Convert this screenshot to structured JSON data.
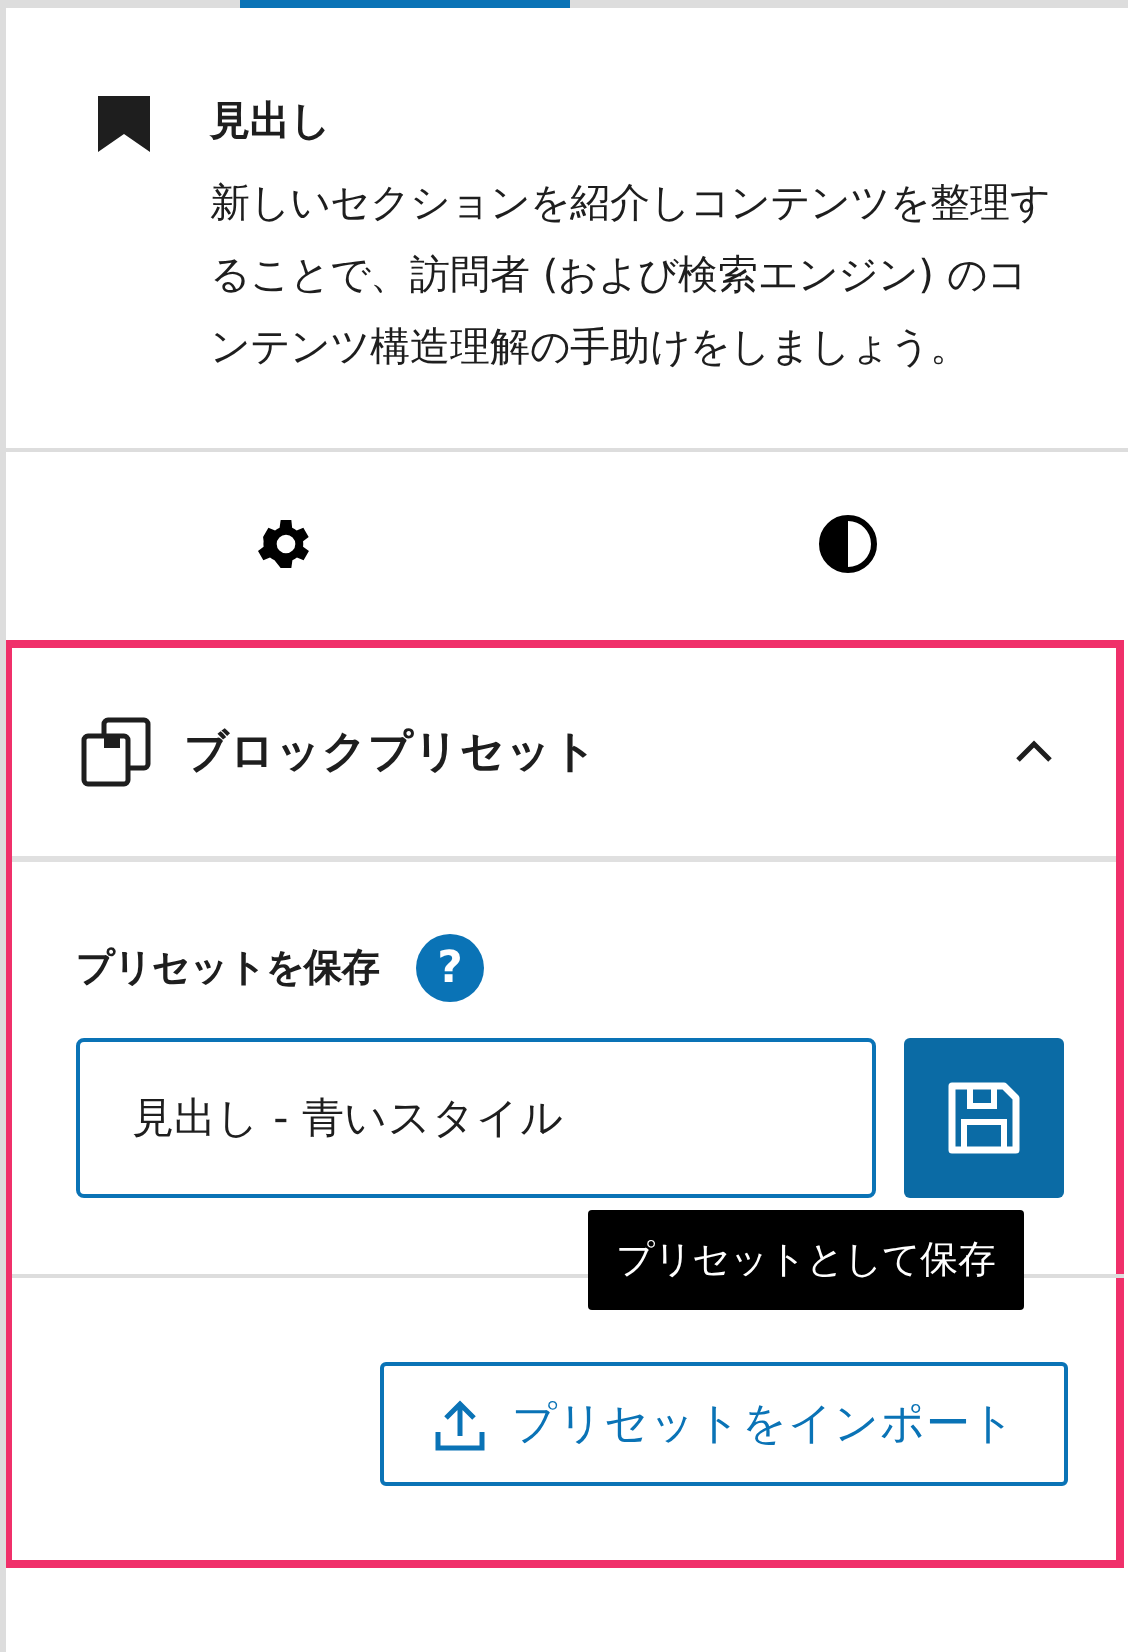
{
  "block": {
    "title": "見出し",
    "description": "新しいセクションを紹介しコンテンツを整理することで、訪問者 (および検索エンジン) のコンテンツ構造理解の手助けをしましょう。"
  },
  "tabs": [
    {
      "kind": "settings",
      "selected": false
    },
    {
      "kind": "styles",
      "selected": false
    }
  ],
  "panel": {
    "title": "ブロックプリセット",
    "expanded": true,
    "save_label": "プリセットを保存",
    "help": "?",
    "preset_name": "見出し - 青いスタイル",
    "tooltip": "プリセットとして保存",
    "import_button": "プリセットをインポート"
  }
}
